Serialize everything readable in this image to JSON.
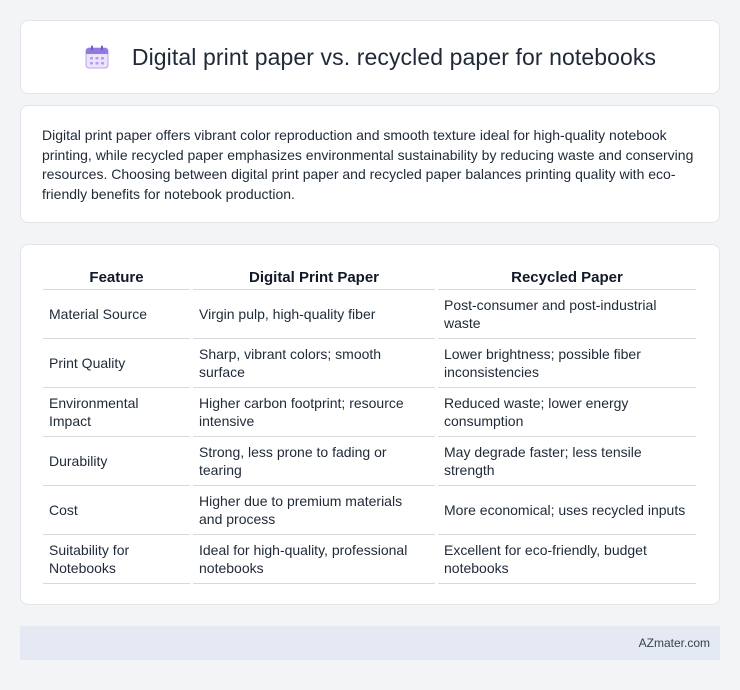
{
  "header": {
    "icon": "calendar-icon",
    "title": "Digital print paper vs. recycled paper for notebooks"
  },
  "intro": {
    "text": "Digital print paper offers vibrant color reproduction and smooth texture ideal for high-quality notebook printing, while recycled paper emphasizes environmental sustainability by reducing waste and conserving resources. Choosing between digital print paper and recycled paper balances printing quality with eco-friendly benefits for notebook production."
  },
  "table": {
    "headers": [
      "Feature",
      "Digital Print Paper",
      "Recycled Paper"
    ],
    "rows": [
      [
        "Material Source",
        "Virgin pulp, high-quality fiber",
        "Post-consumer and post-industrial waste"
      ],
      [
        "Print Quality",
        "Sharp, vibrant colors; smooth surface",
        "Lower brightness; possible fiber inconsistencies"
      ],
      [
        "Environmental Impact",
        "Higher carbon footprint; resource intensive",
        "Reduced waste; lower energy consumption"
      ],
      [
        "Durability",
        "Strong, less prone to fading or tearing",
        "May degrade faster; less tensile strength"
      ],
      [
        "Cost",
        "Higher due to premium materials and process",
        "More economical; uses recycled inputs"
      ],
      [
        "Suitability for Notebooks",
        "Ideal for high-quality, professional notebooks",
        "Excellent for eco-friendly, budget notebooks"
      ]
    ]
  },
  "footer": {
    "brand": "AZmater.com"
  }
}
